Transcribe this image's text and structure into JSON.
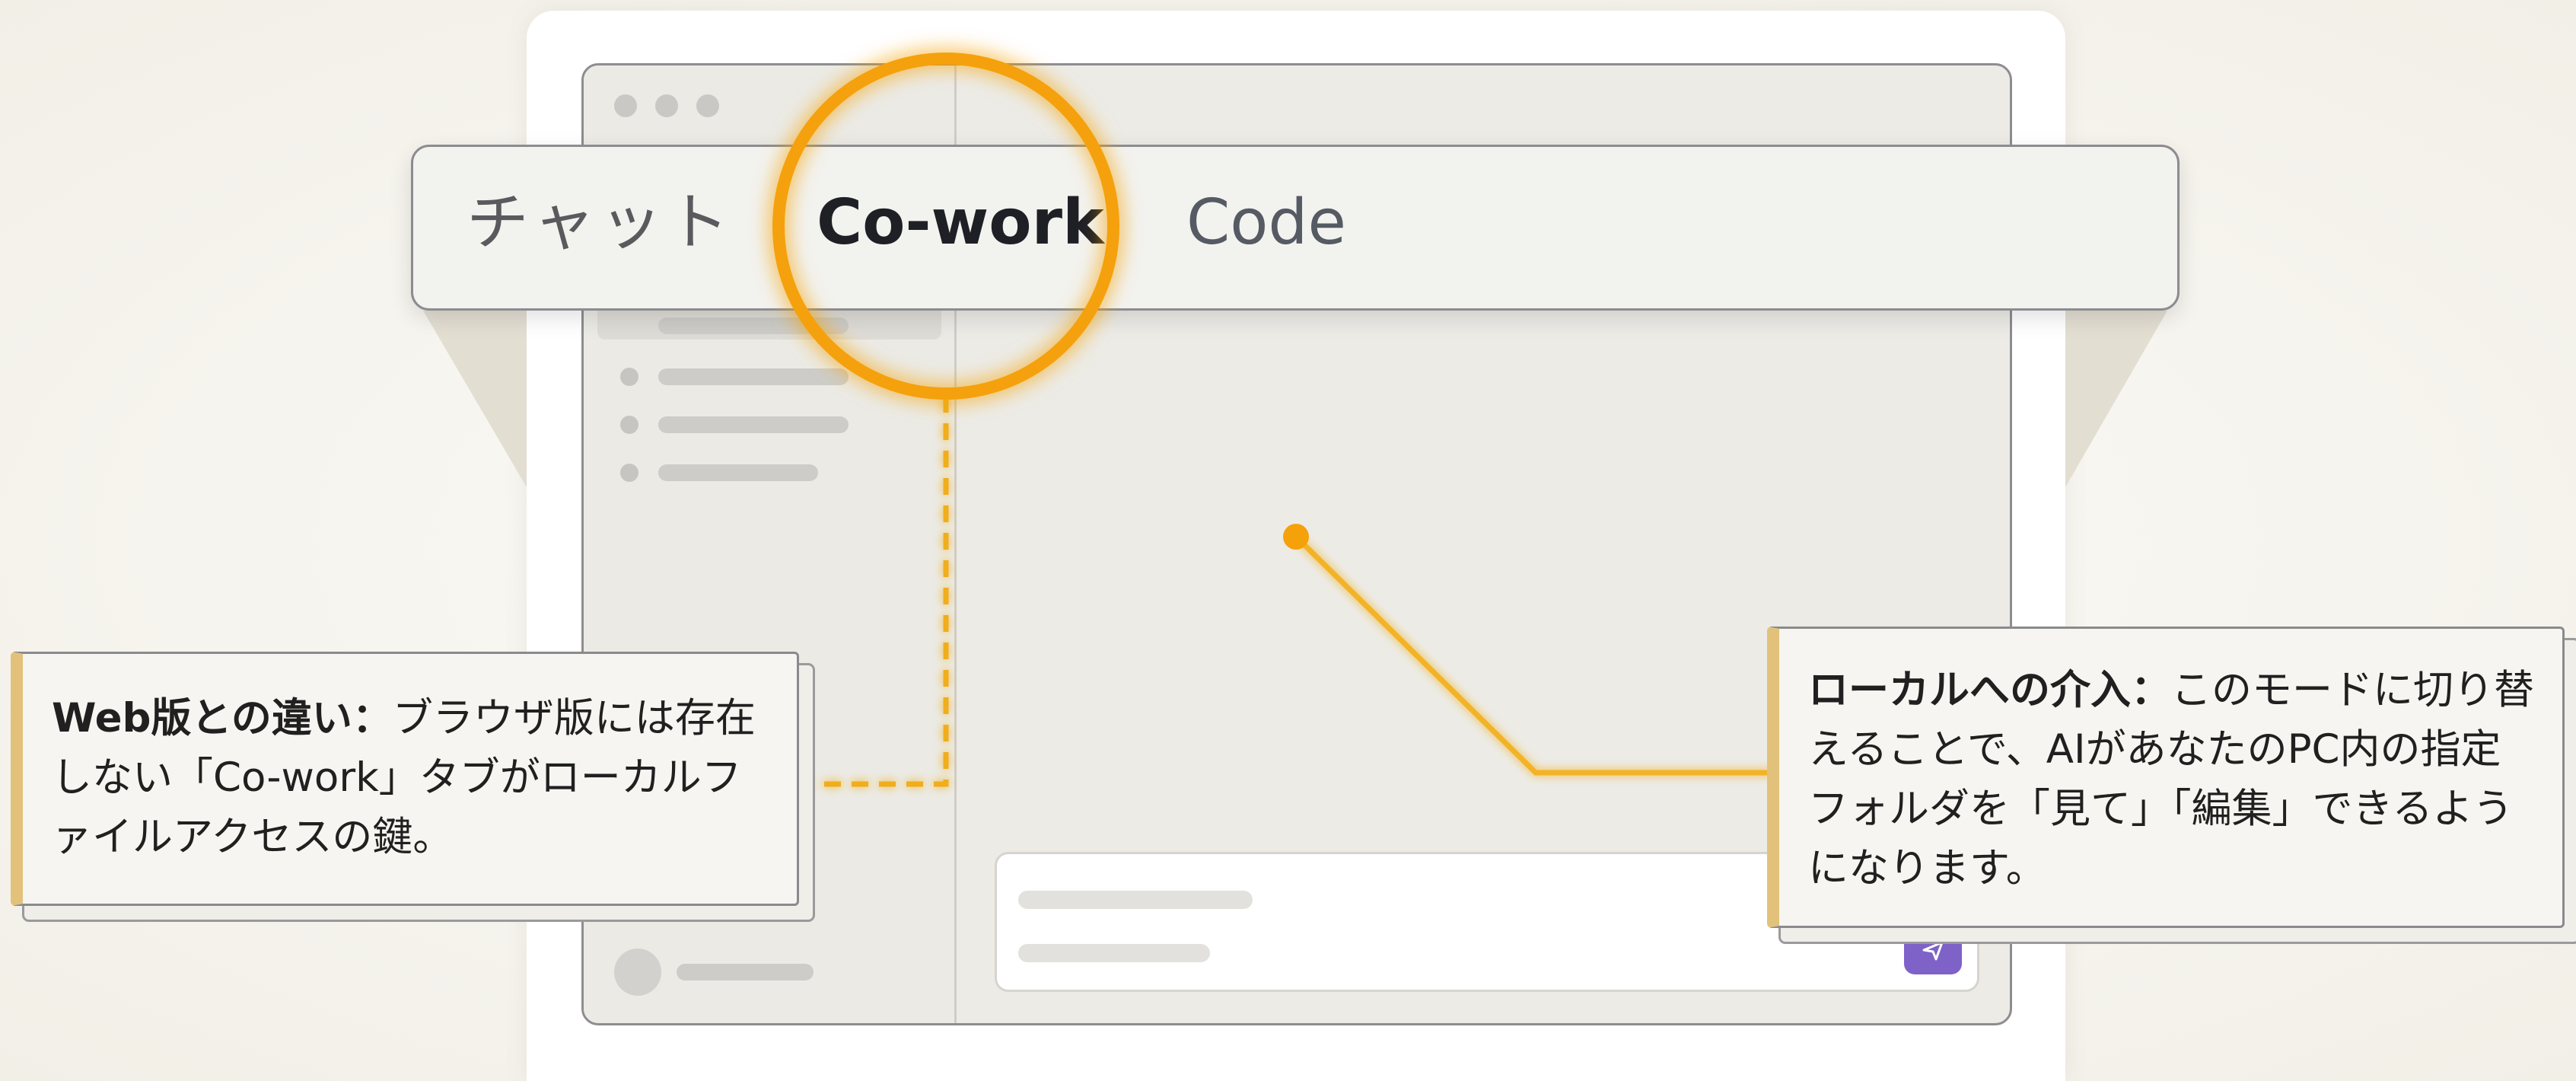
{
  "tabs": [
    {
      "label": "チャット",
      "selected": false
    },
    {
      "label": "Co-work",
      "selected": true
    },
    {
      "label": "Code",
      "selected": false
    }
  ],
  "callouts": {
    "left": {
      "title": "Web版との違い：",
      "body": "ブラウザ版には存在しない「Co-work」タブがローカルファイルアクセスの鍵。"
    },
    "right": {
      "title": "ローカルへの介入：",
      "body": "このモードに切り替えることで、AIがあなたのPC内の指定フォルダを「見て」「編集」できるようになります。"
    }
  },
  "icons": {
    "send": "send-icon"
  },
  "colors": {
    "highlight": "#f5a10a",
    "callout_accent": "#e2c27a",
    "send_button": "#7e62c8"
  }
}
